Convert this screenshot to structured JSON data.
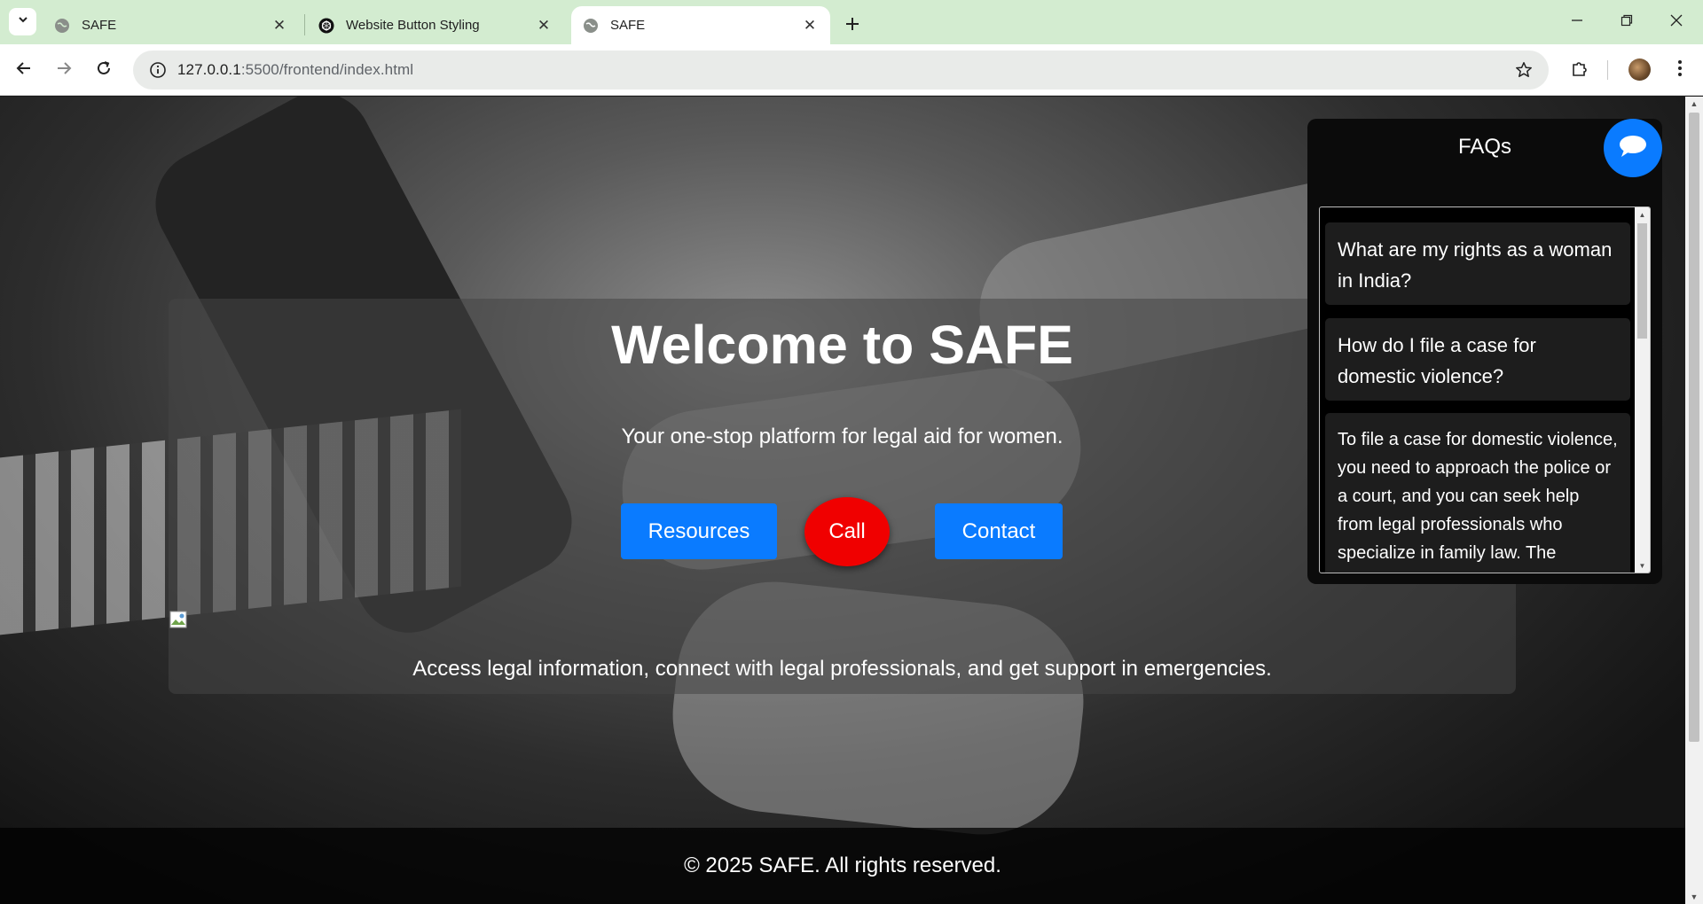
{
  "browser": {
    "tabs": [
      {
        "title": "SAFE",
        "active": false
      },
      {
        "title": "Website Button Styling",
        "active": false
      },
      {
        "title": "SAFE",
        "active": true
      }
    ],
    "url_host": "127.0.0.1",
    "url_path": ":5500/frontend/index.html",
    "icons": {
      "tab_search": "chevron-down-icon",
      "new_tab": "plus-icon",
      "back": "arrow-left-icon",
      "forward": "arrow-right-icon",
      "reload": "reload-icon",
      "site_info": "info-icon",
      "bookmark": "star-icon",
      "extensions": "puzzle-icon",
      "menu": "more-vertical-icon"
    }
  },
  "hero": {
    "title": "Welcome to SAFE",
    "tagline": "Your one-stop platform for legal aid for women.",
    "buttons": {
      "resources": "Resources",
      "call": "Call",
      "contact": "Contact"
    },
    "subline": "Access legal information, connect with legal professionals, and get support in emergencies."
  },
  "footer": {
    "text": "© 2025 SAFE. All rights reserved."
  },
  "faq": {
    "title": "FAQs",
    "questions": [
      "What are my rights as a woman in India?",
      "How do I file a case for domestic violence?"
    ],
    "answer": "To file a case for domestic violence, you need to approach the police or a court, and you can seek help from legal professionals who specialize in family law. The"
  },
  "colors": {
    "accent_blue": "#0a7bff",
    "call_red": "#f00000",
    "tabstrip": "#d3ecd0"
  }
}
